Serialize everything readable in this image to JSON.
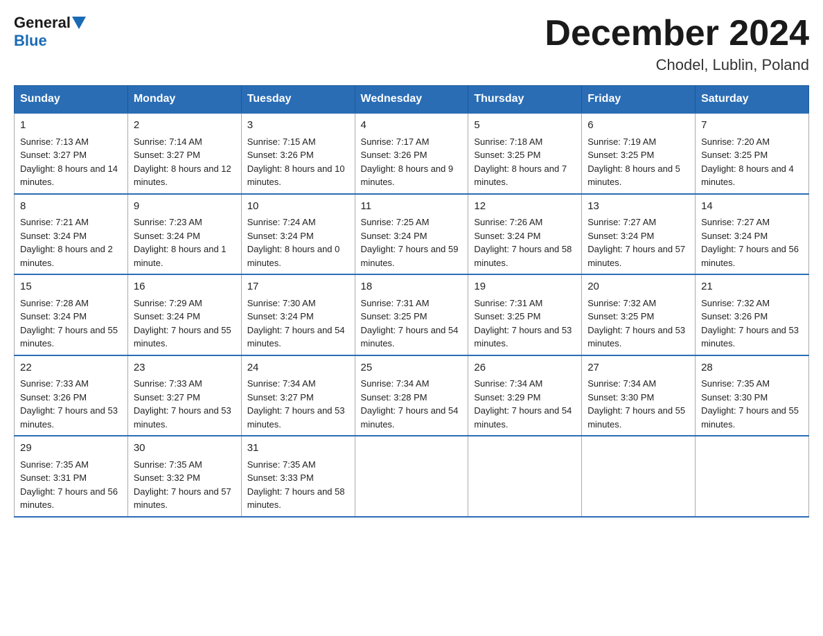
{
  "header": {
    "logo_general": "General",
    "logo_blue": "Blue",
    "month_title": "December 2024",
    "location": "Chodel, Lublin, Poland"
  },
  "days_of_week": [
    "Sunday",
    "Monday",
    "Tuesday",
    "Wednesday",
    "Thursday",
    "Friday",
    "Saturday"
  ],
  "weeks": [
    [
      {
        "day": "1",
        "sunrise": "7:13 AM",
        "sunset": "3:27 PM",
        "daylight": "8 hours and 14 minutes."
      },
      {
        "day": "2",
        "sunrise": "7:14 AM",
        "sunset": "3:27 PM",
        "daylight": "8 hours and 12 minutes."
      },
      {
        "day": "3",
        "sunrise": "7:15 AM",
        "sunset": "3:26 PM",
        "daylight": "8 hours and 10 minutes."
      },
      {
        "day": "4",
        "sunrise": "7:17 AM",
        "sunset": "3:26 PM",
        "daylight": "8 hours and 9 minutes."
      },
      {
        "day": "5",
        "sunrise": "7:18 AM",
        "sunset": "3:25 PM",
        "daylight": "8 hours and 7 minutes."
      },
      {
        "day": "6",
        "sunrise": "7:19 AM",
        "sunset": "3:25 PM",
        "daylight": "8 hours and 5 minutes."
      },
      {
        "day": "7",
        "sunrise": "7:20 AM",
        "sunset": "3:25 PM",
        "daylight": "8 hours and 4 minutes."
      }
    ],
    [
      {
        "day": "8",
        "sunrise": "7:21 AM",
        "sunset": "3:24 PM",
        "daylight": "8 hours and 2 minutes."
      },
      {
        "day": "9",
        "sunrise": "7:23 AM",
        "sunset": "3:24 PM",
        "daylight": "8 hours and 1 minute."
      },
      {
        "day": "10",
        "sunrise": "7:24 AM",
        "sunset": "3:24 PM",
        "daylight": "8 hours and 0 minutes."
      },
      {
        "day": "11",
        "sunrise": "7:25 AM",
        "sunset": "3:24 PM",
        "daylight": "7 hours and 59 minutes."
      },
      {
        "day": "12",
        "sunrise": "7:26 AM",
        "sunset": "3:24 PM",
        "daylight": "7 hours and 58 minutes."
      },
      {
        "day": "13",
        "sunrise": "7:27 AM",
        "sunset": "3:24 PM",
        "daylight": "7 hours and 57 minutes."
      },
      {
        "day": "14",
        "sunrise": "7:27 AM",
        "sunset": "3:24 PM",
        "daylight": "7 hours and 56 minutes."
      }
    ],
    [
      {
        "day": "15",
        "sunrise": "7:28 AM",
        "sunset": "3:24 PM",
        "daylight": "7 hours and 55 minutes."
      },
      {
        "day": "16",
        "sunrise": "7:29 AM",
        "sunset": "3:24 PM",
        "daylight": "7 hours and 55 minutes."
      },
      {
        "day": "17",
        "sunrise": "7:30 AM",
        "sunset": "3:24 PM",
        "daylight": "7 hours and 54 minutes."
      },
      {
        "day": "18",
        "sunrise": "7:31 AM",
        "sunset": "3:25 PM",
        "daylight": "7 hours and 54 minutes."
      },
      {
        "day": "19",
        "sunrise": "7:31 AM",
        "sunset": "3:25 PM",
        "daylight": "7 hours and 53 minutes."
      },
      {
        "day": "20",
        "sunrise": "7:32 AM",
        "sunset": "3:25 PM",
        "daylight": "7 hours and 53 minutes."
      },
      {
        "day": "21",
        "sunrise": "7:32 AM",
        "sunset": "3:26 PM",
        "daylight": "7 hours and 53 minutes."
      }
    ],
    [
      {
        "day": "22",
        "sunrise": "7:33 AM",
        "sunset": "3:26 PM",
        "daylight": "7 hours and 53 minutes."
      },
      {
        "day": "23",
        "sunrise": "7:33 AM",
        "sunset": "3:27 PM",
        "daylight": "7 hours and 53 minutes."
      },
      {
        "day": "24",
        "sunrise": "7:34 AM",
        "sunset": "3:27 PM",
        "daylight": "7 hours and 53 minutes."
      },
      {
        "day": "25",
        "sunrise": "7:34 AM",
        "sunset": "3:28 PM",
        "daylight": "7 hours and 54 minutes."
      },
      {
        "day": "26",
        "sunrise": "7:34 AM",
        "sunset": "3:29 PM",
        "daylight": "7 hours and 54 minutes."
      },
      {
        "day": "27",
        "sunrise": "7:34 AM",
        "sunset": "3:30 PM",
        "daylight": "7 hours and 55 minutes."
      },
      {
        "day": "28",
        "sunrise": "7:35 AM",
        "sunset": "3:30 PM",
        "daylight": "7 hours and 55 minutes."
      }
    ],
    [
      {
        "day": "29",
        "sunrise": "7:35 AM",
        "sunset": "3:31 PM",
        "daylight": "7 hours and 56 minutes."
      },
      {
        "day": "30",
        "sunrise": "7:35 AM",
        "sunset": "3:32 PM",
        "daylight": "7 hours and 57 minutes."
      },
      {
        "day": "31",
        "sunrise": "7:35 AM",
        "sunset": "3:33 PM",
        "daylight": "7 hours and 58 minutes."
      },
      null,
      null,
      null,
      null
    ]
  ],
  "labels": {
    "sunrise": "Sunrise:",
    "sunset": "Sunset:",
    "daylight": "Daylight:"
  }
}
